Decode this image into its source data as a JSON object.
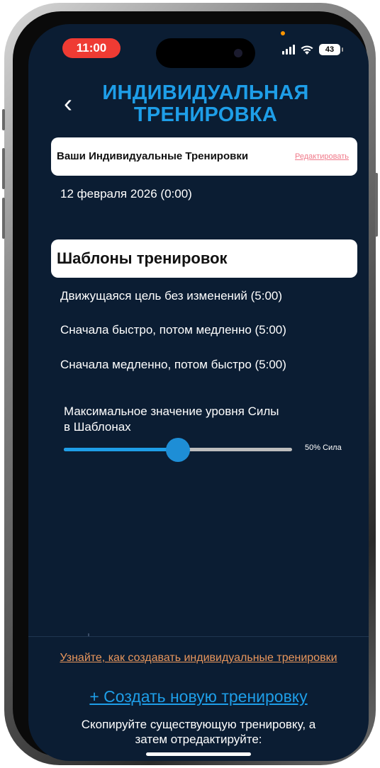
{
  "status_bar": {
    "time": "11:00",
    "battery": "43",
    "icons": [
      "signal-icon",
      "wifi-icon",
      "battery-icon"
    ]
  },
  "header": {
    "back_icon": "chevron-left-icon",
    "back_glyph": "‹",
    "title_line1": "ИНДИВИДУАЛЬНАЯ",
    "title_line2": "ТРЕНИРОВКА"
  },
  "custom_workouts": {
    "title": "Ваши Индивидуальные Тренировки",
    "edit_label": "Редактировать",
    "items": [
      {
        "label": "12 февраля 2026 (0:00)"
      }
    ]
  },
  "templates": {
    "title": "Шаблоны тренировок",
    "items": [
      {
        "label": "Движущаяся цель без изменений (5:00)"
      },
      {
        "label": "Сначала быстро, потом медленно (5:00)"
      },
      {
        "label": "Сначала медленно, потом быстро (5:00)"
      }
    ]
  },
  "strength_slider": {
    "label_line1": "Максимальное значение уровня Силы",
    "label_line2": "в Шаблонах",
    "value": 50,
    "value_label": "50% Сила"
  },
  "footer": {
    "learn_link": "Узнайте, как создавать индивидуальные тренировки",
    "create_link": "+ Создать новую тренировку",
    "copy_hint_line1": "Скопируйте существующую тренировку, а",
    "copy_hint_line2": "затем отредактируйте:"
  },
  "colors": {
    "background": "#0b1d33",
    "accent": "#1e9ee8",
    "link_orange": "#e8965c",
    "edit_pink": "#f07a8a",
    "time_pill": "#ef3b33"
  }
}
